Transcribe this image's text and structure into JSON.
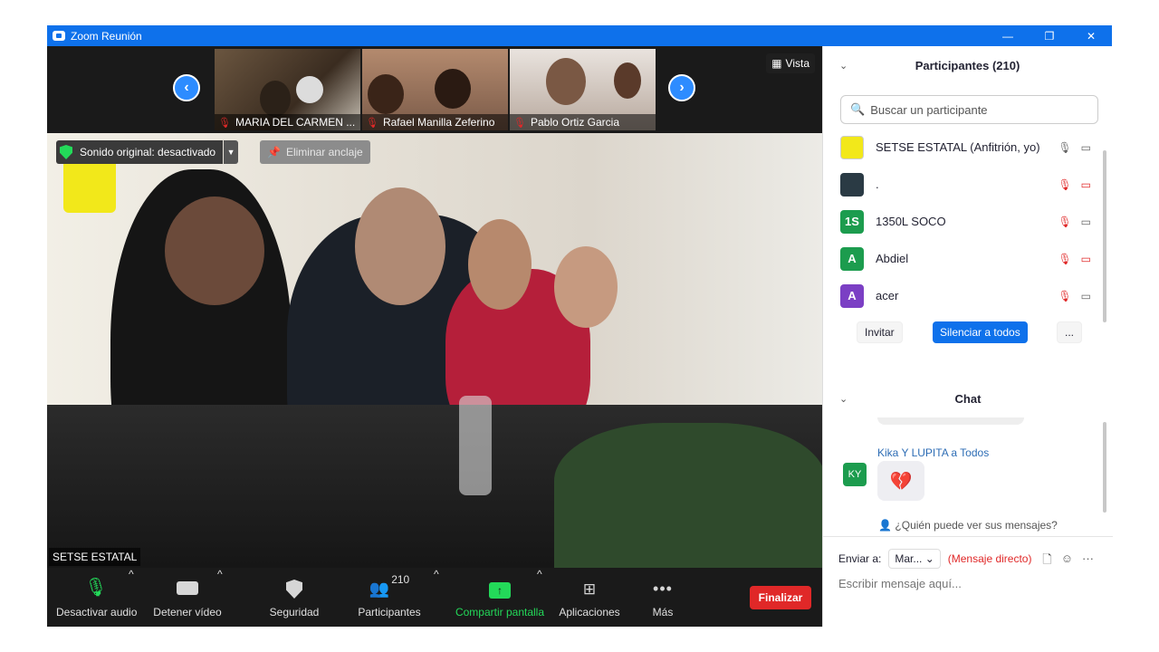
{
  "window": {
    "title": "Zoom Reunión",
    "minimize": "—",
    "restore": "❐",
    "close": "✕"
  },
  "strip": {
    "thumbnails": [
      {
        "name": "MARIA DEL CARMEN ..."
      },
      {
        "name": "Rafael Manilla Zeferino"
      },
      {
        "name": "Pablo Ortiz Garcia"
      }
    ],
    "prev_arrow": "‹",
    "next_arrow": "›",
    "view_label": "Vista"
  },
  "main_video": {
    "original_sound": "Sonido original: desactivado",
    "unpin": "Eliminar anclaje",
    "speaker_name": "SETSE ESTATAL"
  },
  "toolbar": {
    "audio": "Desactivar audio",
    "video": "Detener vídeo",
    "security": "Seguridad",
    "participants": "Participantes",
    "participants_count": "210",
    "share": "Compartir pantalla",
    "apps": "Aplicaciones",
    "more": "Más",
    "end": "Finalizar"
  },
  "participants_panel": {
    "title": "Participantes (210)",
    "search_placeholder": "Buscar un participante",
    "participants": [
      {
        "name": "SETSE ESTATAL (Anfitrión, yo)",
        "avatar": "",
        "color": "#ffffff"
      },
      {
        "name": ".",
        "avatar": "",
        "color": "#2a3a44"
      },
      {
        "name": "1350L SOCO",
        "avatar": "1S",
        "color": "#1c9c4e"
      },
      {
        "name": "Abdiel",
        "avatar": "A",
        "color": "#1c9c4e"
      },
      {
        "name": "acer",
        "avatar": "A",
        "color": "#7b3fc4"
      }
    ],
    "invite": "Invitar",
    "mute_all": "Silenciar a todos",
    "more": "..."
  },
  "chat": {
    "title": "Chat",
    "sender": "Kika Y LUPITA a Todos",
    "sender_initials": "KY",
    "message_icon": "broken-heart",
    "who_can_see": "¿Quién puede ver sus mensajes?",
    "send_to_label": "Enviar a:",
    "recipient": "Mar...",
    "dm_tag": "(Mensaje directo)",
    "input_placeholder": "Escribir mensaje aquí..."
  },
  "colors": {
    "zoom_blue": "#0e71eb",
    "end_red": "#e02828",
    "share_green": "#23d959"
  }
}
